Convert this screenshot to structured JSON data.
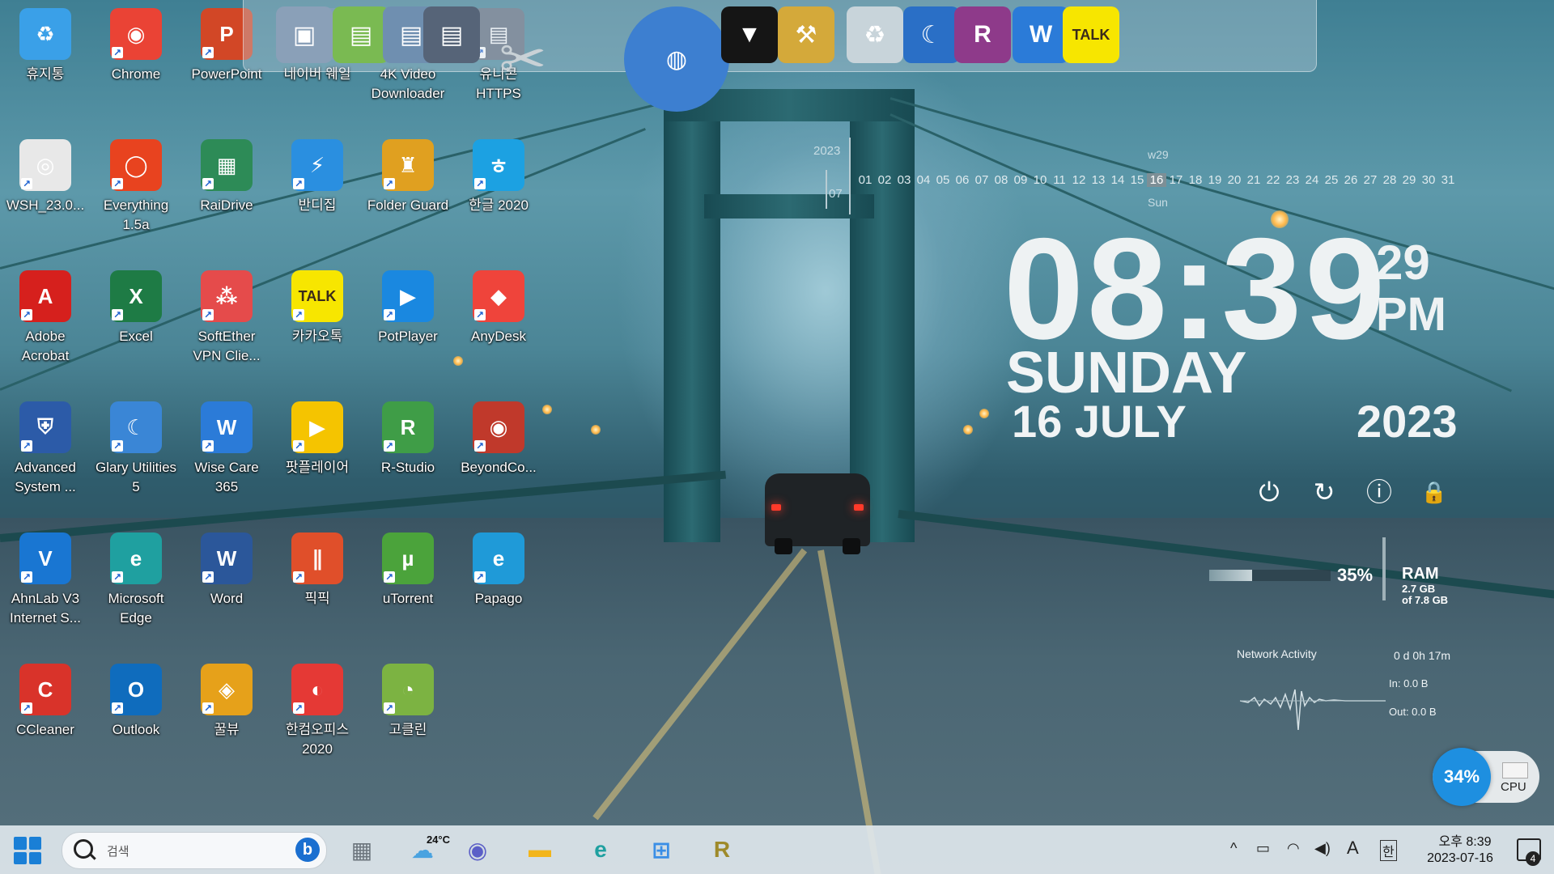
{
  "desktop": {
    "icons": [
      {
        "label": "휴지통",
        "icon": "recycle-bin-icon",
        "color": "#3aa0e8",
        "glyph": "♻"
      },
      {
        "label": "Chrome",
        "icon": "chrome-icon",
        "color": "#ea4335",
        "glyph": "◉"
      },
      {
        "label": "PowerPoint",
        "icon": "powerpoint-icon",
        "color": "#d24726",
        "glyph": "P"
      },
      {
        "label": "네이버 웨일",
        "icon": "network-computer-icon",
        "color": "#5b7fa6",
        "glyph": "▣"
      },
      {
        "label": "4K Video Downloader",
        "icon": "folder-green-icon",
        "color": "#6aa84f",
        "glyph": "▤"
      },
      {
        "label": "유니콘 HTTPS",
        "icon": "folder-dark-icon",
        "color": "#5e6b7c",
        "glyph": "▤"
      },
      {
        "label": "WSH_23.0...",
        "icon": "installer-disc-icon",
        "color": "#e8e8e8",
        "glyph": "◎"
      },
      {
        "label": "Everything 1.5a",
        "icon": "everything-search-icon",
        "color": "#e8431f",
        "glyph": "◯"
      },
      {
        "label": "RaiDrive",
        "icon": "raidrive-icon",
        "color": "#2d8b57",
        "glyph": "▦"
      },
      {
        "label": "반디집",
        "icon": "bandizip-icon",
        "color": "#2a8fe0",
        "glyph": "⚡"
      },
      {
        "label": "Folder Guard",
        "icon": "folder-guard-icon",
        "color": "#e0a020",
        "glyph": "♜"
      },
      {
        "label": "한글 2020",
        "icon": "hangul-icon",
        "color": "#1ca1e2",
        "glyph": "ㅎ"
      },
      {
        "label": "Adobe Acrobat",
        "icon": "acrobat-icon",
        "color": "#d6201d",
        "glyph": "A"
      },
      {
        "label": "Excel",
        "icon": "excel-icon",
        "color": "#1e7b45",
        "glyph": "X"
      },
      {
        "label": "SoftEther VPN Clie...",
        "icon": "softether-icon",
        "color": "#e54b4b",
        "glyph": "⁂"
      },
      {
        "label": "카카오톡",
        "icon": "kakaotalk-icon",
        "color": "#f7e600",
        "glyph": "TALK"
      },
      {
        "label": "PotPlayer",
        "icon": "potplayer-icon",
        "color": "#1a88e0",
        "glyph": "▶"
      },
      {
        "label": "AnyDesk",
        "icon": "anydesk-icon",
        "color": "#ef443b",
        "glyph": "◆"
      },
      {
        "label": "Advanced System ...",
        "icon": "advanced-systemcare-icon",
        "color": "#2c5ba8",
        "glyph": "⛨"
      },
      {
        "label": "Glary Utilities 5",
        "icon": "glary-utilities-icon",
        "color": "#3a86d6",
        "glyph": "☾"
      },
      {
        "label": "Wise Care 365",
        "icon": "wise-care-icon",
        "color": "#2b7bd8",
        "glyph": "W"
      },
      {
        "label": "팟플레이어",
        "icon": "potplayer-yellow-icon",
        "color": "#f5c400",
        "glyph": "▶"
      },
      {
        "label": "R-Studio",
        "icon": "r-studio-icon",
        "color": "#3f9d47",
        "glyph": "R"
      },
      {
        "label": "BeyondCo...",
        "icon": "beyond-compare-icon",
        "color": "#c0392b",
        "glyph": "◉"
      },
      {
        "label": "AhnLab V3 Internet S...",
        "icon": "ahnlab-v3-icon",
        "color": "#1976d2",
        "glyph": "V"
      },
      {
        "label": "Microsoft Edge",
        "icon": "edge-icon",
        "color": "#1fa0a0",
        "glyph": "e"
      },
      {
        "label": "Word",
        "icon": "word-icon",
        "color": "#2b579a",
        "glyph": "W"
      },
      {
        "label": "픽픽",
        "icon": "picpick-icon",
        "color": "#e04f2a",
        "glyph": "∥"
      },
      {
        "label": "uTorrent",
        "icon": "utorrent-icon",
        "color": "#4ba33b",
        "glyph": "µ"
      },
      {
        "label": "Papago",
        "icon": "papago-icon",
        "color": "#1f9ad8",
        "glyph": "e"
      },
      {
        "label": "CCleaner",
        "icon": "ccleaner-icon",
        "color": "#d9332a",
        "glyph": "C"
      },
      {
        "label": "Outlook",
        "icon": "outlook-icon",
        "color": "#0f6cbd",
        "glyph": "O"
      },
      {
        "label": "꿀뷰",
        "icon": "honeyview-icon",
        "color": "#e6a11a",
        "glyph": "◈"
      },
      {
        "label": "한컴오피스 2020",
        "icon": "hancom-office-icon",
        "color": "#e53935",
        "glyph": "◐"
      },
      {
        "label": "고클린",
        "icon": "goclean-icon",
        "color": "#7cb342",
        "glyph": "◔"
      }
    ]
  },
  "dock": {
    "items": [
      {
        "icon": "computer-network-icon",
        "color": "#8aa0b8",
        "glyph": "▣"
      },
      {
        "icon": "folder-green-icon",
        "color": "#7aba52",
        "glyph": "▤"
      },
      {
        "icon": "folder-blue-icon",
        "color": "#6f8fb0",
        "glyph": "▤"
      },
      {
        "icon": "folder-dark-icon",
        "color": "#566478",
        "glyph": "▤"
      },
      {
        "icon": "system-tools-icon",
        "color": "#9aa4aa",
        "glyph": "✂"
      },
      {
        "icon": "globe-icon",
        "color": "#3d7fd0",
        "glyph": "◍"
      },
      {
        "icon": "tshirt-icon",
        "color": "#151515",
        "glyph": "▼"
      },
      {
        "icon": "hammer-tools-icon",
        "color": "#d4a93a",
        "glyph": "⚒"
      },
      {
        "icon": "recycle-bin-icon",
        "color": "#c8d4da",
        "glyph": "♻"
      },
      {
        "icon": "glary-utilities-icon",
        "color": "#2a6fc6",
        "glyph": "☾"
      },
      {
        "icon": "rar-archive-icon",
        "color": "#8e3a8a",
        "glyph": "R"
      },
      {
        "icon": "wise-care-icon",
        "color": "#2b7bd8",
        "glyph": "W"
      },
      {
        "icon": "kakaotalk-icon",
        "color": "#f7e600",
        "glyph": "TALK"
      }
    ]
  },
  "calendar": {
    "year": "2023",
    "month": "07",
    "week": "w29",
    "weekday_short": "Sun",
    "days": [
      "01",
      "02",
      "03",
      "04",
      "05",
      "06",
      "07",
      "08",
      "09",
      "10",
      "11",
      "12",
      "13",
      "14",
      "15",
      "16",
      "17",
      "18",
      "19",
      "20",
      "21",
      "22",
      "23",
      "24",
      "25",
      "26",
      "27",
      "28",
      "29",
      "30",
      "31"
    ],
    "today": "16"
  },
  "clock": {
    "time": "08:39",
    "seconds": "29",
    "ampm": "PM",
    "weekday": "SUNDAY",
    "date": "16 JULY",
    "year": "2023"
  },
  "power_controls": [
    {
      "icon": "power-icon",
      "glyph": "⏻"
    },
    {
      "icon": "restart-icon",
      "glyph": "↻"
    },
    {
      "icon": "shutdown-icon",
      "glyph": "ⓘ"
    },
    {
      "icon": "lock-icon",
      "glyph": "🔒"
    }
  ],
  "ram": {
    "percent_label": "35%",
    "percent": 0.35,
    "title": "RAM",
    "used": "2.7 GB",
    "total": "of 7.8 GB"
  },
  "network": {
    "title": "Network Activity",
    "uptime": "0 d 0h 17m",
    "in": "In: 0.0 B",
    "out": "Out: 0.0 B"
  },
  "cpu": {
    "percent_label": "34%",
    "label": "CPU"
  },
  "taskbar": {
    "search_placeholder": "검색",
    "weather": "24°C",
    "apps": [
      {
        "icon": "task-view-icon",
        "color": "#6c757d"
      },
      {
        "icon": "weather-icon",
        "color": "#4aa3e0"
      },
      {
        "icon": "teams-chat-icon",
        "color": "#5b5fc7"
      },
      {
        "icon": "file-explorer-icon",
        "color": "#f2b51b"
      },
      {
        "icon": "edge-icon",
        "color": "#1fa0a0"
      },
      {
        "icon": "microsoft-store-icon",
        "color": "#3a8ee6"
      },
      {
        "icon": "rar-archive-icon",
        "color": "#9e8a2a"
      }
    ],
    "tray": {
      "ime_mode": "A",
      "ime_lang": "한"
    },
    "time": "오후 8:39",
    "date": "2023-07-16",
    "notification_count": "4"
  }
}
